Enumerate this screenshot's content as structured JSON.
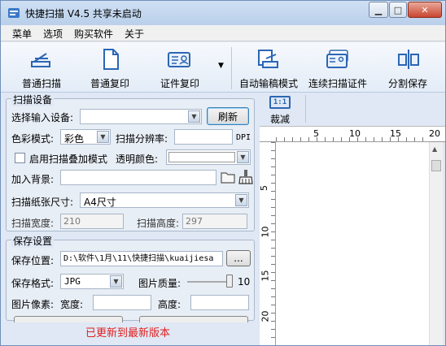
{
  "window": {
    "title": "快捷扫描 V4.5 共享未启动"
  },
  "menu": {
    "items": [
      "菜单",
      "选项",
      "购买软件",
      "关于"
    ]
  },
  "toolbar": {
    "buttons": [
      "普通扫描",
      "普通复印",
      "证件复印",
      "自动输稿模式",
      "连续扫描证件",
      "分割保存"
    ],
    "dropdown_arrow": "▼"
  },
  "scan_settings": {
    "title": "扫描设备",
    "device_label": "选择输入设备:",
    "device_value": "",
    "refresh_label": "刷新",
    "color_mode_label": "色彩模式:",
    "color_mode_value": "彩色",
    "resolution_label": "扫描分辨率:",
    "resolution_value": "",
    "dpi_unit": "DPI",
    "overlay_label": "启用扫描叠加模式",
    "transparent_label": "透明颜色:",
    "background_label": "加入背景:",
    "background_value": "",
    "paper_size_label": "扫描纸张尺寸:",
    "paper_size_value": "A4尺寸",
    "width_label": "扫描宽度:",
    "width_value": "210",
    "height_label": "扫描高度:",
    "height_value": "297"
  },
  "save_settings": {
    "title": "保存设置",
    "location_label": "保存位置:",
    "location_value": "D:\\软件\\1月\\11\\快捷扫描\\kuaijiesa",
    "browse_label": "...",
    "format_label": "保存格式:",
    "format_value": "JPG",
    "quality_label": "图片质量:",
    "quality_value": "10",
    "pixel_label": "图片像素:",
    "pixel_width_label": "宽度:",
    "pixel_width_value": "",
    "pixel_height_label": "高度:",
    "pixel_height_value": ""
  },
  "status": {
    "update_text": "已更新到最新版本"
  },
  "preview": {
    "crop_label": "裁减",
    "crop_icon_text": "1:1",
    "h_ticks": [
      "5",
      "10",
      "15",
      "20"
    ],
    "v_ticks": [
      "5",
      "10",
      "15",
      "20"
    ]
  },
  "colors": {
    "accent": "#2b66b4",
    "update": "#e02020",
    "window_bg": "#dfe8f4"
  }
}
